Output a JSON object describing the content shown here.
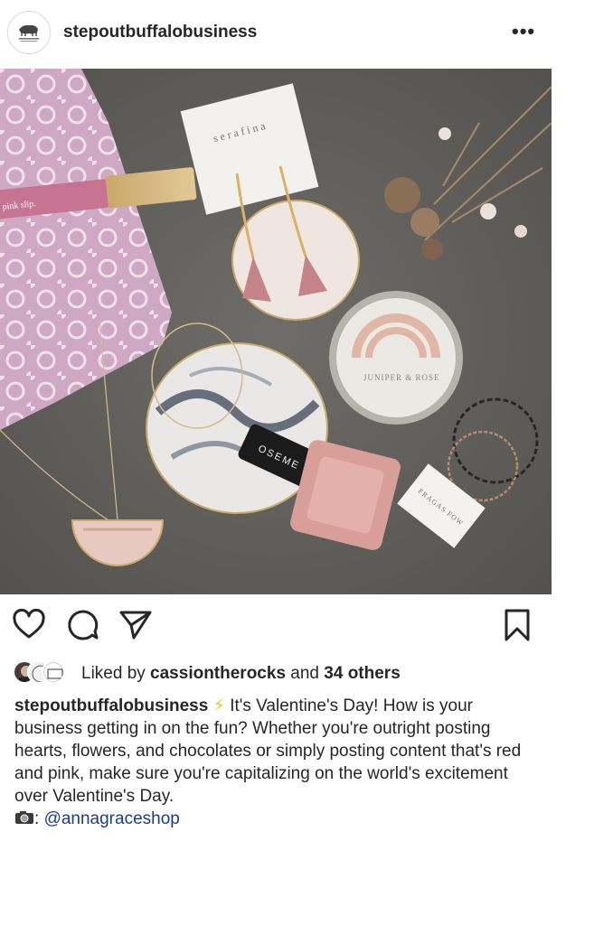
{
  "post": {
    "username": "stepoutbuffalobusiness",
    "more_label": "•••"
  },
  "likes": {
    "prefix": "Liked by ",
    "liker": "cassiontherocks",
    "middle": " and ",
    "others": "34 others"
  },
  "caption": {
    "username": "stepoutbuffalobusiness",
    "emoji": "⚡",
    "text": "It's Valentine's Day! How is your business getting in on the fun? Whether you're outright posting hearts, flowers, and chocolates or simply posting content that's red and pink, make sure you're capitalizing on the world's excitement over Valentine's Day.",
    "credit_sep": ": ",
    "mention": "@annagraceshop"
  },
  "photo": {
    "card_text": "serafina",
    "lipgloss_text": "pink slip.",
    "tin_text": "JUNIPER & ROSE",
    "polish_text": "OSEME",
    "tag_text": "FRAGAS FOW"
  },
  "icons": {
    "like": "heart-icon",
    "comment": "comment-icon",
    "share": "paper-plane-icon",
    "save": "bookmark-icon",
    "options": "more-dots-icon"
  },
  "colors": {
    "text": "#262626",
    "mention": "#1f3a8a",
    "background": "#ffffff"
  }
}
